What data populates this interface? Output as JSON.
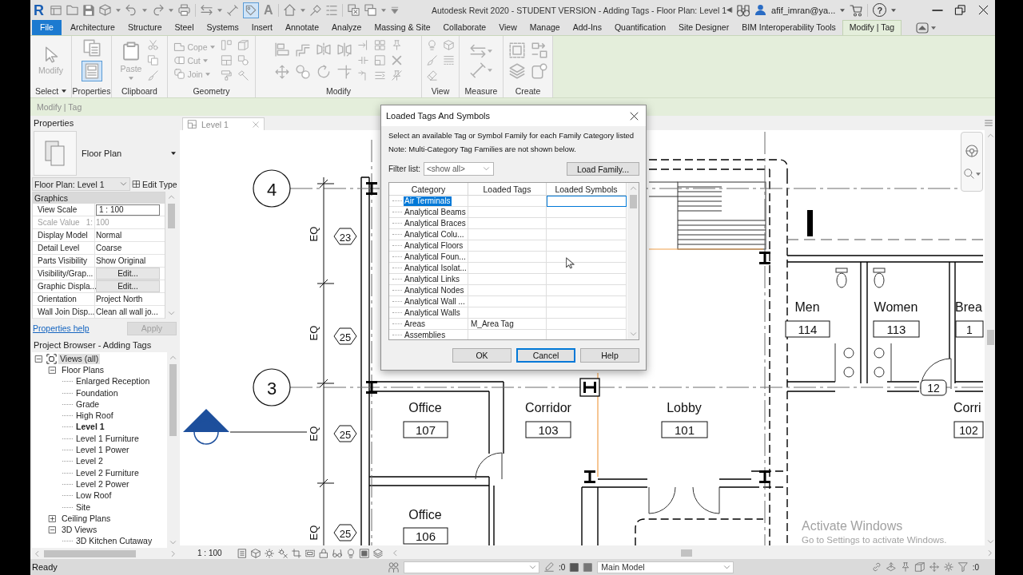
{
  "title_bar": {
    "logo": "R",
    "text_tool": "A",
    "tag_tool_active": true,
    "title": "Autodesk Revit 2020 - STUDENT VERSION - Adding Tags - Floor Plan: Level 1",
    "user": "afif_imran@ya...",
    "help": "?"
  },
  "ribbon_tabs": [
    {
      "label": "File",
      "kind": "file",
      "selected": false
    },
    {
      "label": "Architecture",
      "kind": "tab",
      "selected": false
    },
    {
      "label": "Structure",
      "kind": "tab",
      "selected": false
    },
    {
      "label": "Steel",
      "kind": "tab",
      "selected": false
    },
    {
      "label": "Systems",
      "kind": "tab",
      "selected": false
    },
    {
      "label": "Insert",
      "kind": "tab",
      "selected": false
    },
    {
      "label": "Annotate",
      "kind": "tab",
      "selected": false
    },
    {
      "label": "Analyze",
      "kind": "tab",
      "selected": false
    },
    {
      "label": "Massing & Site",
      "kind": "tab",
      "selected": false
    },
    {
      "label": "Collaborate",
      "kind": "tab",
      "selected": false
    },
    {
      "label": "View",
      "kind": "tab",
      "selected": false
    },
    {
      "label": "Manage",
      "kind": "tab",
      "selected": false
    },
    {
      "label": "Add-Ins",
      "kind": "tab",
      "selected": false
    },
    {
      "label": "Quantification",
      "kind": "tab",
      "selected": false
    },
    {
      "label": "Site Designer",
      "kind": "tab",
      "selected": false
    },
    {
      "label": "BIM Interoperability Tools",
      "kind": "tab",
      "selected": false
    },
    {
      "label": "Modify | Tag",
      "kind": "contextual",
      "selected": true
    }
  ],
  "ribbon_panels": [
    {
      "label": "Select",
      "tools": [
        {
          "label": "Modify",
          "disabled": true
        }
      ]
    },
    {
      "label": "Properties",
      "toggle_on": true
    },
    {
      "label": "Clipboard",
      "tools": [
        {
          "label": "Paste",
          "disabled": true
        }
      ]
    },
    {
      "label": "Geometry",
      "tools": [
        {
          "label": "Cope",
          "disabled": true
        },
        {
          "label": "Cut",
          "disabled": true
        },
        {
          "label": "Join",
          "disabled": true
        }
      ]
    },
    {
      "label": "Modify"
    },
    {
      "label": "View"
    },
    {
      "label": "Measure"
    },
    {
      "label": "Create"
    }
  ],
  "options_bar": {
    "label": "Modify | Tag"
  },
  "properties": {
    "title": "Properties",
    "type_name": "Floor Plan",
    "instance": "Floor Plan: Level 1",
    "edit_type": "Edit Type",
    "group": "Graphics",
    "rows": [
      {
        "name": "View Scale",
        "value": "1 : 100",
        "kind": "input"
      },
      {
        "name": "Scale Value",
        "prefix": "1:",
        "value": "100",
        "kind": "readonly"
      },
      {
        "name": "Display Model",
        "value": "Normal",
        "kind": "text"
      },
      {
        "name": "Detail Level",
        "value": "Coarse",
        "kind": "text"
      },
      {
        "name": "Parts Visibility",
        "value": "Show Original",
        "kind": "text"
      },
      {
        "name": "Visibility/Grap...",
        "value": "Edit...",
        "kind": "button"
      },
      {
        "name": "Graphic Displa...",
        "value": "Edit...",
        "kind": "button"
      },
      {
        "name": "Orientation",
        "value": "Project North",
        "kind": "text"
      },
      {
        "name": "Wall Join Disp...",
        "value": "Clean all wall jo...",
        "kind": "text"
      }
    ],
    "help_link": "Properties help",
    "apply": {
      "label": "Apply",
      "disabled": true
    }
  },
  "project_browser": {
    "title": "Project Browser - Adding Tags",
    "tree": [
      {
        "label": "Views (all)",
        "expanded": true,
        "selected": true,
        "children": [
          {
            "label": "Floor Plans",
            "expanded": true,
            "selected": false,
            "children": [
              {
                "label": "Enlarged Reception",
                "active": false,
                "selected": false
              },
              {
                "label": "Foundation",
                "active": false,
                "selected": false
              },
              {
                "label": "Grade",
                "active": false,
                "selected": false
              },
              {
                "label": "High Roof",
                "active": false,
                "selected": false
              },
              {
                "label": "Level 1",
                "active": true,
                "selected": false
              },
              {
                "label": "Level 1 Furniture",
                "active": false,
                "selected": false
              },
              {
                "label": "Level 1 Power",
                "active": false,
                "selected": false
              },
              {
                "label": "Level 2",
                "active": false,
                "selected": false
              },
              {
                "label": "Level 2 Furniture",
                "active": false,
                "selected": false
              },
              {
                "label": "Level 2 Power",
                "active": false,
                "selected": false
              },
              {
                "label": "Low Roof",
                "active": false,
                "selected": false
              },
              {
                "label": "Site",
                "active": false,
                "selected": false
              }
            ]
          },
          {
            "label": "Ceiling Plans",
            "expanded": false,
            "selected": false
          },
          {
            "label": "3D Views",
            "expanded": true,
            "selected": false,
            "children": [
              {
                "label": "3D Kitchen Cutaway",
                "active": false,
                "selected": false
              }
            ]
          }
        ]
      }
    ]
  },
  "view_tab": {
    "label": "Level 1"
  },
  "canvas": {
    "grid_bubbles": [
      {
        "label": "4"
      },
      {
        "label": "3"
      }
    ],
    "dimension_labels": [
      "EQ",
      "EQ",
      "EQ",
      "EQ"
    ],
    "wall_tags": [
      "23",
      "25",
      "25",
      "25"
    ],
    "rooms": [
      {
        "name": "Office",
        "number": "107"
      },
      {
        "name": "Corridor",
        "number": "103"
      },
      {
        "name": "Lobby",
        "number": "101"
      },
      {
        "name": "Men",
        "number": "114"
      },
      {
        "name": "Women",
        "number": "113"
      },
      {
        "name": "Brea",
        "number": "1"
      },
      {
        "name": "Corri",
        "number": "102"
      },
      {
        "name": "Office",
        "number": "106"
      }
    ],
    "door_tags": [
      "12"
    ]
  },
  "dialog": {
    "title": "Loaded Tags And Symbols",
    "instruction": "Select an available Tag or Symbol Family for each Family Category listed",
    "note": "Note: Multi-Category Tag Families are not shown below.",
    "filter_label": "Filter list:",
    "filter_value": "<show all>",
    "load_button": "Load Family...",
    "columns": [
      "Category",
      "Loaded Tags",
      "Loaded Symbols"
    ],
    "rows": [
      {
        "category": "Air Terminals",
        "selected": true
      },
      {
        "category": "Analytical Beams",
        "selected": false
      },
      {
        "category": "Analytical Braces",
        "selected": false
      },
      {
        "category": "Analytical Colu...",
        "selected": false
      },
      {
        "category": "Analytical Floors",
        "selected": false
      },
      {
        "category": "Analytical Foun...",
        "selected": false
      },
      {
        "category": "Analytical Isolat...",
        "selected": false
      },
      {
        "category": "Analytical Links",
        "selected": false
      },
      {
        "category": "Analytical Nodes",
        "selected": false
      },
      {
        "category": "Analytical Wall ...",
        "selected": false
      },
      {
        "category": "Analytical Walls",
        "selected": false
      },
      {
        "category": "Areas",
        "loaded_tags": "M_Area Tag",
        "selected": false
      },
      {
        "category": "Assemblies",
        "selected": false
      }
    ],
    "buttons": [
      {
        "label": "OK",
        "focused": false
      },
      {
        "label": "Cancel",
        "focused": true
      },
      {
        "label": "Help",
        "focused": false
      }
    ]
  },
  "activation_notice": {
    "title": "Activate Windows",
    "text": "Go to Settings to activate Windows."
  },
  "view_control_bar": {
    "scale": "1 : 100"
  },
  "status_bar": {
    "text": "Ready",
    "counter": ":0",
    "model": "Main Model",
    "filter_counter": ":0"
  }
}
